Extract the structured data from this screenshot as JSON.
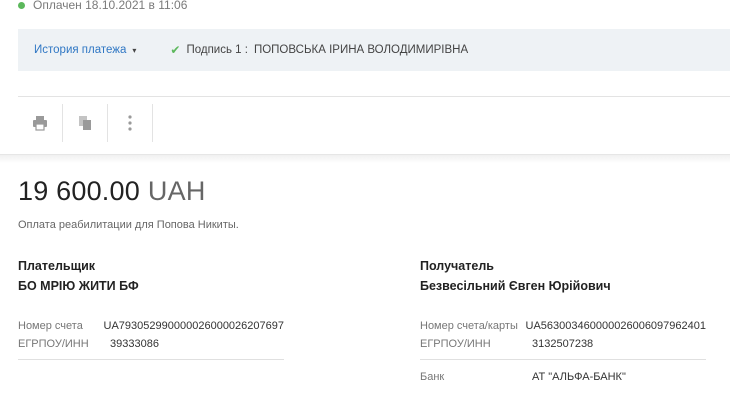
{
  "status": {
    "text": "Оплачен 18.10.2021 в 11:06",
    "color": "#5cb85c"
  },
  "history": {
    "link_label": "История платежа",
    "caret_icon": "▾",
    "signature_label": "Подпись 1 :",
    "signature_name": "ПОПОВСЬКА ІРИНА ВОЛОДИМИРІВНА",
    "check_icon": "✔"
  },
  "toolbar": {
    "icons": [
      "print-icon",
      "copy-icon",
      "more-vertical-icon"
    ]
  },
  "payment": {
    "amount": "19 600.00",
    "currency": "UAH",
    "purpose": "Оплата реабилитации для Попова Никиты."
  },
  "payer": {
    "title": "Плательщик",
    "name": "БО МРІЮ ЖИТИ БФ",
    "account_label": "Номер счета",
    "account_value": "UA793052990000026000026207697",
    "edrpou_label": "ЕГРПОУ/ИНН",
    "edrpou_value": "39333086"
  },
  "recipient": {
    "title": "Получатель",
    "name": "Безвесільний Євген Юрійович",
    "account_label": "Номер счета/карты",
    "account_value": "UA563003460000026006097962401",
    "edrpou_label": "ЕГРПОУ/ИНН",
    "edrpou_value": "3132507238",
    "bank_label": "Банк",
    "bank_value": "АТ \"АЛЬФА-БАНК\""
  },
  "colors": {
    "accent_link": "#2f77c4",
    "band_background": "#eef2f5",
    "success": "#5cb85c"
  }
}
